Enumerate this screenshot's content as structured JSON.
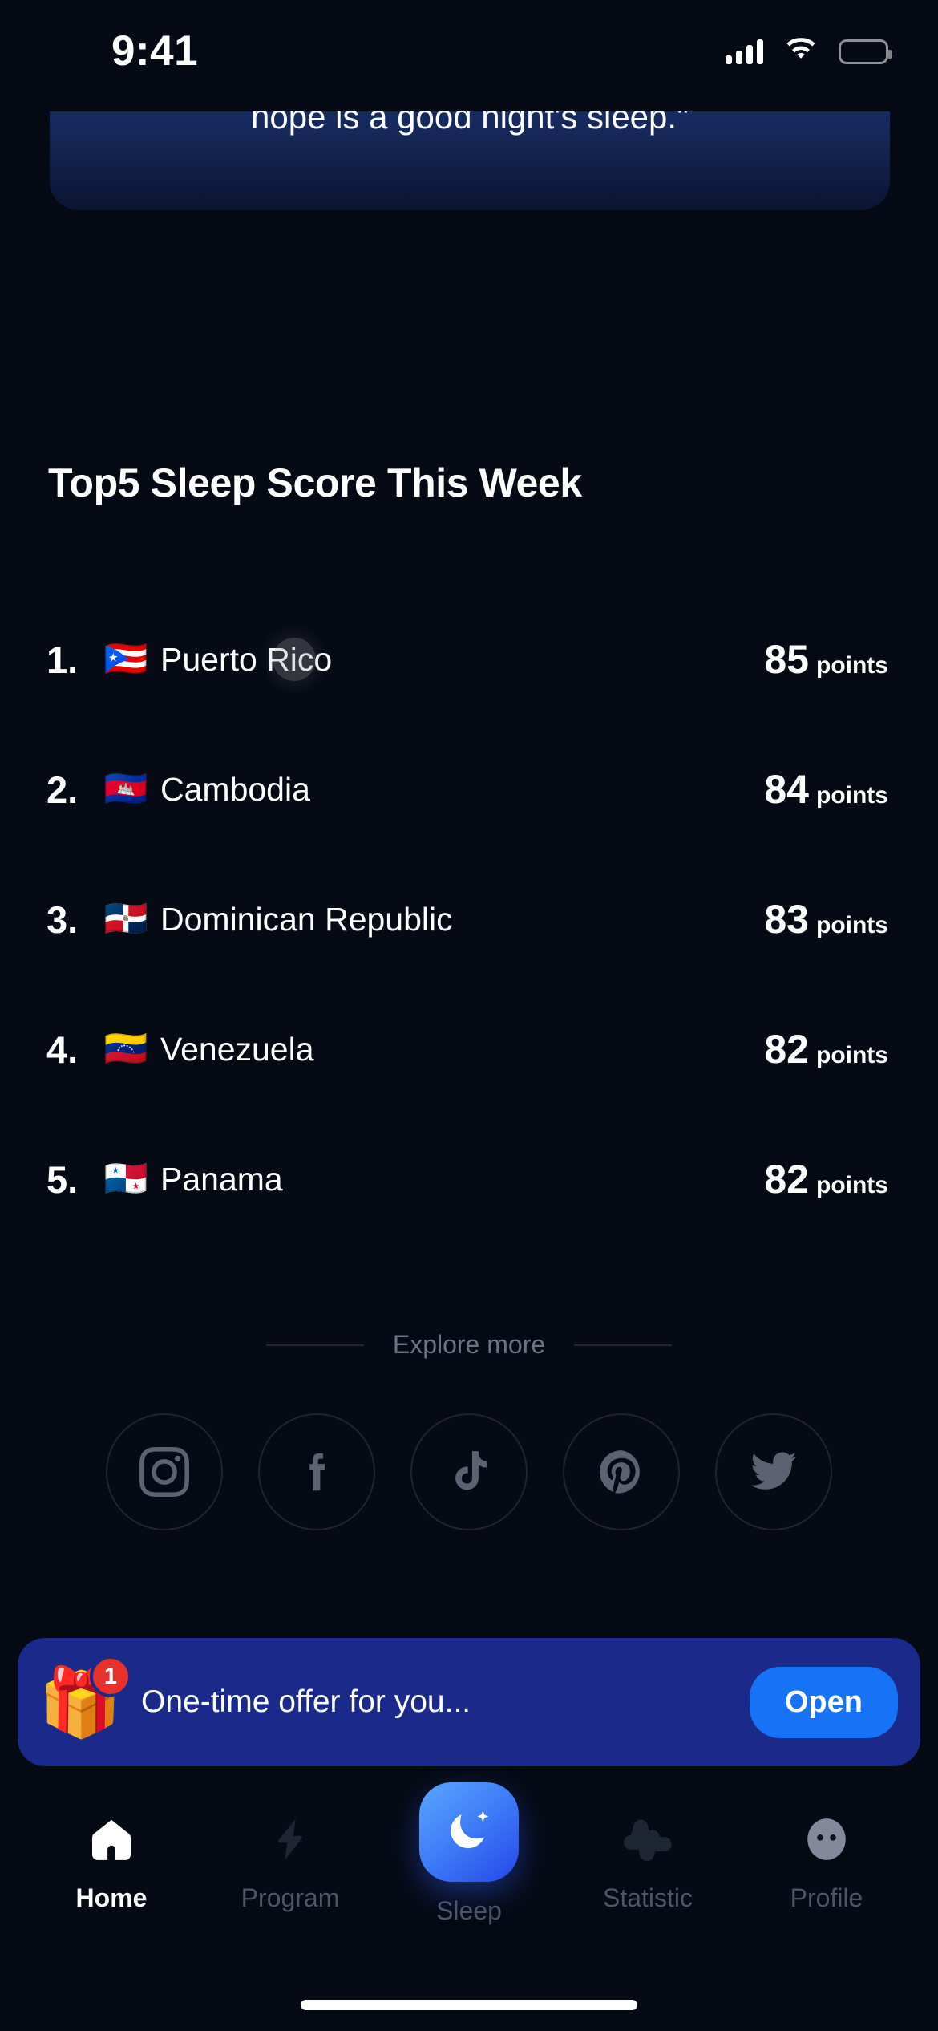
{
  "status_bar": {
    "time": "9:41",
    "signal_icon": "cellular-signal-icon",
    "wifi_icon": "wifi-icon",
    "battery_icon": "battery-icon"
  },
  "quote_card": {
    "text": "hope is a good night's sleep.\"",
    "gradient_from": "#172a63",
    "gradient_to": "#0b1530"
  },
  "leaderboard": {
    "title": "Top5 Sleep Score This Week",
    "unit_label": "points",
    "rows": [
      {
        "rank": "1.",
        "flag": "🇵🇷",
        "country": "Puerto Rico",
        "score": "85",
        "unit": "points"
      },
      {
        "rank": "2.",
        "flag": "🇰🇭",
        "country": "Cambodia",
        "score": "84",
        "unit": "points"
      },
      {
        "rank": "3.",
        "flag": "🇩🇴",
        "country": "Dominican Republic",
        "score": "83",
        "unit": "points"
      },
      {
        "rank": "4.",
        "flag": "🇻🇪",
        "country": "Venezuela",
        "score": "82",
        "unit": "points"
      },
      {
        "rank": "5.",
        "flag": "🇵🇦",
        "country": "Panama",
        "score": "82",
        "unit": "points"
      }
    ]
  },
  "explore": {
    "label": "Explore more",
    "socials": [
      {
        "name": "instagram",
        "icon": "instagram-icon"
      },
      {
        "name": "facebook",
        "icon": "facebook-icon"
      },
      {
        "name": "tiktok",
        "icon": "tiktok-icon"
      },
      {
        "name": "pinterest",
        "icon": "pinterest-icon"
      },
      {
        "name": "twitter",
        "icon": "twitter-icon"
      }
    ]
  },
  "offer_banner": {
    "icon": "gift-icon",
    "emoji": "🎁",
    "badge_count": "1",
    "text": "One-time offer for you...",
    "button_label": "Open",
    "bg_color": "#1b2a8a",
    "button_color": "#1773f5",
    "badge_color": "#e6322a"
  },
  "tab_bar": {
    "active": "Home",
    "items": [
      {
        "label": "Home",
        "icon": "home-icon",
        "active": true
      },
      {
        "label": "Program",
        "icon": "bolt-icon",
        "active": false
      },
      {
        "label": "Sleep",
        "icon": "moon-star-icon",
        "active": false
      },
      {
        "label": "Statistic",
        "icon": "pulse-icon",
        "active": false
      },
      {
        "label": "Profile",
        "icon": "avatar-icon",
        "active": false
      }
    ]
  },
  "colors": {
    "background": "#060a14",
    "accent_blue": "#1773f5",
    "text_primary": "#ffffff",
    "text_muted": "#4e5566"
  }
}
